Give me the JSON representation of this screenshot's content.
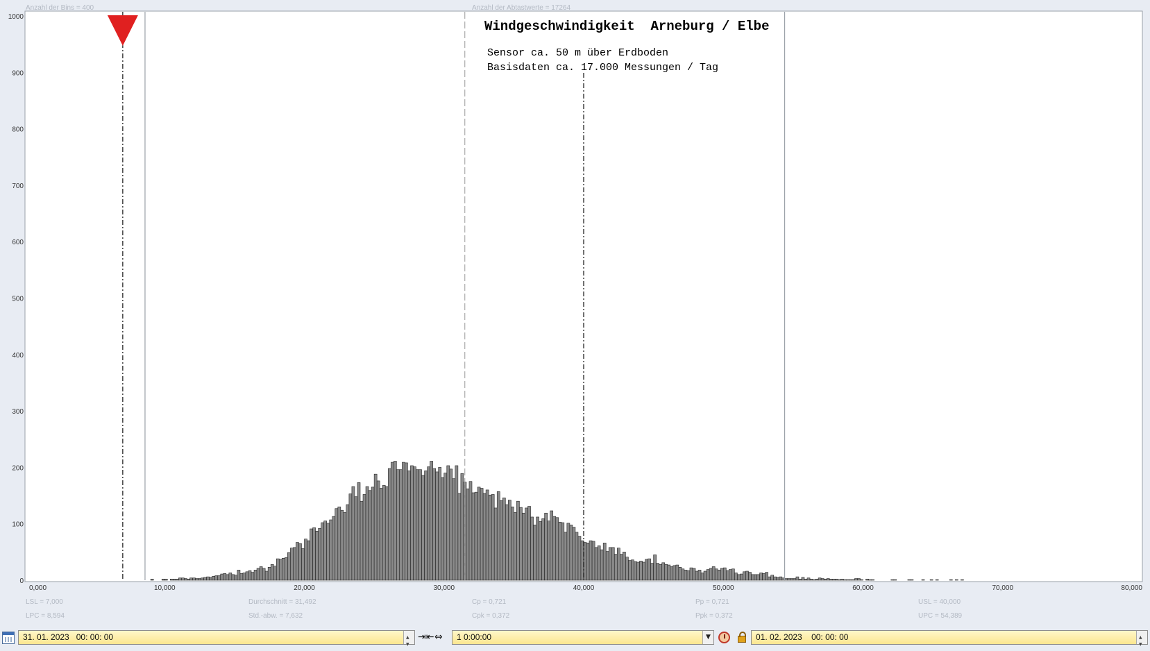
{
  "header": {
    "bins_label": "Anzahl der Bins =   400",
    "samples_label": "Anzahl der Abtastwerte = 17264"
  },
  "chart_data": {
    "type": "bar",
    "title": "Windgeschwindigkeit  Arneburg / Elbe",
    "subtitle_lines": [
      "Sensor ca. 50 m über Erdboden",
      "Basisdaten ca. 17.000 Messungen / Tag"
    ],
    "xlim": [
      0,
      80
    ],
    "ylim": [
      0,
      1000
    ],
    "x_ticks": [
      "0,000",
      "10,000",
      "20,000",
      "30,000",
      "40,000",
      "50,000",
      "60,000",
      "70,000",
      "80,000"
    ],
    "y_ticks": [
      "0",
      "100",
      "200",
      "300",
      "400",
      "500",
      "600",
      "700",
      "800",
      "900",
      "1000"
    ],
    "bin_width": 0.2,
    "bins_x_start": [
      9.0,
      9.2,
      9.4,
      9.6,
      9.8,
      10.0,
      10.2,
      10.4,
      10.6,
      10.8,
      11.0,
      11.2,
      11.4,
      11.6,
      11.8,
      12.0,
      12.2,
      12.4,
      12.6,
      12.8,
      13.0,
      13.2,
      13.4,
      13.6,
      13.8,
      14.0,
      14.2,
      14.4,
      14.6,
      14.8,
      15.0,
      15.2,
      15.4,
      15.6,
      15.8,
      16.0,
      16.2,
      16.4,
      16.6,
      16.8,
      17.0,
      17.2,
      17.4,
      17.6,
      17.8,
      18.0,
      18.2,
      18.4,
      18.6,
      18.8,
      19.0,
      19.2,
      19.4,
      19.6,
      19.8,
      20.0,
      20.2,
      20.4,
      20.6,
      20.8,
      21.0,
      21.2,
      21.4,
      21.6,
      21.8,
      22.0,
      22.2,
      22.4,
      22.6,
      22.8,
      23.0,
      23.2,
      23.4,
      23.6,
      23.8,
      24.0,
      24.2,
      24.4,
      24.6,
      24.8,
      25.0,
      25.2,
      25.4,
      25.6,
      25.8,
      26.0,
      26.2,
      26.4,
      26.6,
      26.8,
      27.0,
      27.2,
      27.4,
      27.6,
      27.8,
      28.0,
      28.2,
      28.4,
      28.6,
      28.8,
      29.0,
      29.2,
      29.4,
      29.6,
      29.8,
      30.0,
      30.2,
      30.4,
      30.6,
      30.8,
      31.0,
      31.2,
      31.4,
      31.6,
      31.8,
      32.0,
      32.2,
      32.4,
      32.6,
      32.8,
      33.0,
      33.2,
      33.4,
      33.6,
      33.8,
      34.0,
      34.2,
      34.4,
      34.6,
      34.8,
      35.0,
      35.2,
      35.4,
      35.6,
      35.8,
      36.0,
      36.2,
      36.4,
      36.6,
      36.8,
      37.0,
      37.2,
      37.4,
      37.6,
      37.8,
      38.0,
      38.2,
      38.4,
      38.6,
      38.8,
      39.0,
      39.2,
      39.4,
      39.6,
      39.8,
      40.0,
      40.2,
      40.4,
      40.6,
      40.8,
      41.0,
      41.2,
      41.4,
      41.6,
      41.8,
      42.0,
      42.2,
      42.4,
      42.6,
      42.8,
      43.0,
      43.2,
      43.4,
      43.6,
      43.8,
      44.0,
      44.2,
      44.4,
      44.6,
      44.8,
      45.0,
      45.2,
      45.4,
      45.6,
      45.8,
      46.0,
      46.2,
      46.4,
      46.6,
      46.8,
      47.0,
      47.2,
      47.4,
      47.6,
      47.8,
      48.0,
      48.2,
      48.4,
      48.6,
      48.8,
      49.0,
      49.2,
      49.4,
      49.6,
      49.8,
      50.0,
      50.2,
      50.4,
      50.6,
      50.8,
      51.0,
      51.2,
      51.4,
      51.6,
      51.8,
      52.0,
      52.2,
      52.4,
      52.6,
      52.8,
      53.0,
      53.2,
      53.4,
      53.6,
      53.8,
      54.0,
      54.2,
      54.4,
      54.6,
      54.8,
      55.0,
      55.2,
      55.4,
      55.6,
      55.8,
      56.0,
      56.2,
      56.4,
      56.6,
      56.8,
      57.0,
      57.2,
      57.4,
      57.6,
      57.8,
      58.0,
      58.2,
      58.4,
      58.6,
      58.8,
      59.0,
      59.2,
      59.4,
      59.6,
      59.8,
      60.0,
      60.2,
      60.4,
      60.6,
      60.8,
      61.0,
      61.2,
      61.4,
      61.6,
      61.8,
      62.0,
      62.2,
      62.4,
      62.6,
      62.8,
      63.0,
      63.2,
      63.4,
      63.6,
      63.8,
      64.0,
      64.2,
      64.4,
      64.6,
      64.8,
      65.0,
      65.2,
      65.4,
      65.6,
      65.8,
      66.0,
      66.2,
      66.4,
      66.6,
      66.8,
      67.0,
      67.2,
      67.4,
      67.6,
      67.8,
      68.0,
      68.2,
      68.4,
      68.6,
      68.8,
      69.0,
      69.2,
      69.4,
      69.6,
      69.8,
      70.0,
      70.2,
      70.4,
      70.6,
      70.8,
      71.0,
      71.2,
      71.4,
      71.6,
      71.8,
      72.0,
      72.2,
      72.4,
      72.6,
      72.8,
      73.0,
      73.2,
      73.4,
      73.6,
      73.8,
      74.0,
      74.2,
      74.4,
      74.6,
      74.8,
      75.0,
      75.2,
      75.4,
      75.6,
      75.8,
      76.0,
      76.2,
      76.4,
      76.6,
      76.8
    ],
    "bins_count": [
      2,
      0,
      0,
      0,
      2,
      2,
      0,
      2,
      2,
      2,
      4,
      4,
      3,
      2,
      4,
      4,
      3,
      3,
      4,
      5,
      6,
      5,
      7,
      8,
      8,
      11,
      12,
      10,
      13,
      10,
      9,
      18,
      12,
      13,
      15,
      17,
      14,
      18,
      21,
      24,
      21,
      16,
      23,
      28,
      25,
      38,
      37,
      39,
      40,
      49,
      57,
      58,
      67,
      65,
      56,
      73,
      70,
      91,
      93,
      87,
      92,
      102,
      105,
      101,
      107,
      113,
      127,
      130,
      124,
      120,
      134,
      153,
      166,
      148,
      173,
      140,
      152,
      166,
      159,
      165,
      188,
      176,
      163,
      168,
      166,
      198,
      209,
      211,
      196,
      196,
      209,
      208,
      194,
      203,
      201,
      196,
      196,
      186,
      194,
      201,
      211,
      198,
      192,
      200,
      182,
      190,
      203,
      197,
      180,
      203,
      154,
      189,
      174,
      162,
      175,
      155,
      156,
      165,
      163,
      154,
      160,
      151,
      152,
      128,
      157,
      141,
      146,
      134,
      142,
      130,
      120,
      140,
      129,
      119,
      128,
      131,
      112,
      98,
      112,
      104,
      109,
      119,
      105,
      123,
      113,
      111,
      103,
      102,
      85,
      101,
      98,
      94,
      85,
      78,
      70,
      67,
      66,
      70,
      69,
      58,
      61,
      54,
      66,
      51,
      58,
      58,
      46,
      57,
      46,
      50,
      41,
      35,
      36,
      33,
      32,
      34,
      32,
      37,
      38,
      30,
      45,
      30,
      28,
      31,
      28,
      27,
      24,
      26,
      27,
      23,
      20,
      18,
      17,
      22,
      21,
      16,
      18,
      13,
      16,
      19,
      21,
      24,
      20,
      18,
      21,
      22,
      17,
      19,
      20,
      13,
      10,
      11,
      15,
      16,
      14,
      10,
      10,
      10,
      13,
      12,
      14,
      6,
      9,
      6,
      5,
      6,
      4,
      3,
      3,
      3,
      3,
      6,
      2,
      5,
      2,
      4,
      2,
      1,
      2,
      4,
      3,
      2,
      3,
      2,
      2,
      2,
      1,
      2,
      1,
      1,
      1,
      1,
      3,
      3,
      1,
      0,
      2,
      1,
      1,
      0,
      0,
      0,
      0,
      0,
      0,
      1,
      1,
      0,
      0,
      0,
      0,
      1,
      1,
      0,
      0,
      0,
      1,
      0,
      0,
      1,
      0,
      1,
      0,
      0,
      0,
      0,
      1,
      0,
      1,
      0,
      1,
      0,
      0,
      0,
      0,
      0,
      0,
      0,
      0,
      0,
      0,
      0,
      0,
      0,
      0,
      0,
      0,
      0,
      0,
      0,
      0,
      0,
      0,
      0,
      0,
      0,
      0,
      0,
      0,
      0,
      0,
      0,
      0,
      0,
      0,
      0,
      0,
      0,
      0,
      0,
      0,
      0,
      0,
      0,
      0,
      0,
      0,
      0,
      0,
      0
    ],
    "reference_lines": [
      {
        "id": "lsl",
        "x": 7.0,
        "style": "dash-dot"
      },
      {
        "id": "lpc",
        "x": 8.594,
        "style": "solid"
      },
      {
        "id": "mean",
        "x": 31.492,
        "style": "dashed"
      },
      {
        "id": "usl",
        "x": 40.0,
        "style": "dash-dot"
      },
      {
        "id": "upc",
        "x": 54.389,
        "style": "solid"
      }
    ],
    "marker": {
      "x": 7.0,
      "shape": "triangle-down",
      "color": "#e02020"
    },
    "statistics": [
      [
        "LSL = 7,000",
        "LPC = 8,594"
      ],
      [
        "Durchschnitt  = 31,492",
        "Std.-abw. = 7,632"
      ],
      [
        "Cp  = 0,721",
        "Cpk = 0,372"
      ],
      [
        "Pp  = 0,721",
        "Ppk = 0,372"
      ],
      [
        "USL = 40,000",
        "UPC = 54,389"
      ]
    ]
  },
  "toolbar": {
    "start_datetime": "31. 01. 2023   00: 00: 00",
    "interval": "1 0:00:00",
    "end_datetime": "01. 02. 2023    00: 00: 00"
  }
}
